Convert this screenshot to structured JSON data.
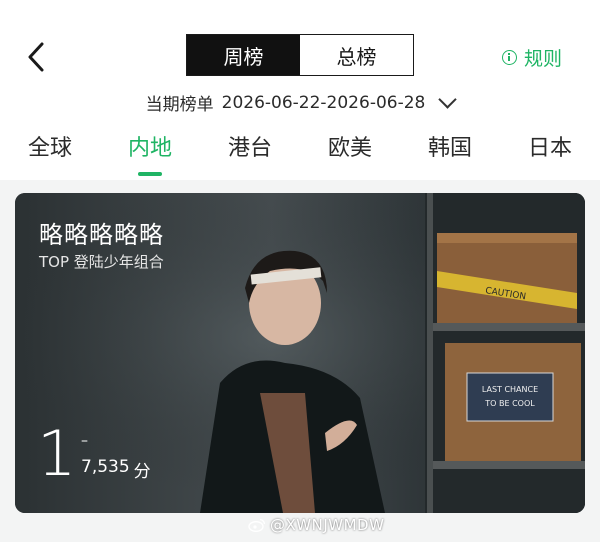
{
  "nav": {
    "back_icon": "chevron-left-icon"
  },
  "segments": {
    "weekly": "周榜",
    "overall": "总榜",
    "active": "weekly"
  },
  "rules": {
    "label": "规则",
    "icon": "info-icon",
    "color": "#1fb464"
  },
  "period": {
    "label": "当期榜单",
    "range": "2026-06-22-2026-06-28",
    "icon": "chevron-down-icon"
  },
  "regions": {
    "items": [
      "全球",
      "内地",
      "港台",
      "欧美",
      "韩国",
      "日本"
    ],
    "active_index": 1
  },
  "chart_entry": {
    "title": "略略略略略",
    "artist": "TOP 登陆少年组合",
    "rank": "1",
    "trend": "–",
    "score": "7,535",
    "score_unit": "分",
    "box_text_top": "CAUTION",
    "box_sign_line1": "LAST CHANCE",
    "box_sign_line2": "TO BE COOL"
  },
  "watermark": {
    "text": "@XWNJWMDW",
    "icon": "weibo-icon"
  },
  "colors": {
    "accent": "#1fb464",
    "segment_active_bg": "#111111",
    "card_bg": "#30363a"
  }
}
